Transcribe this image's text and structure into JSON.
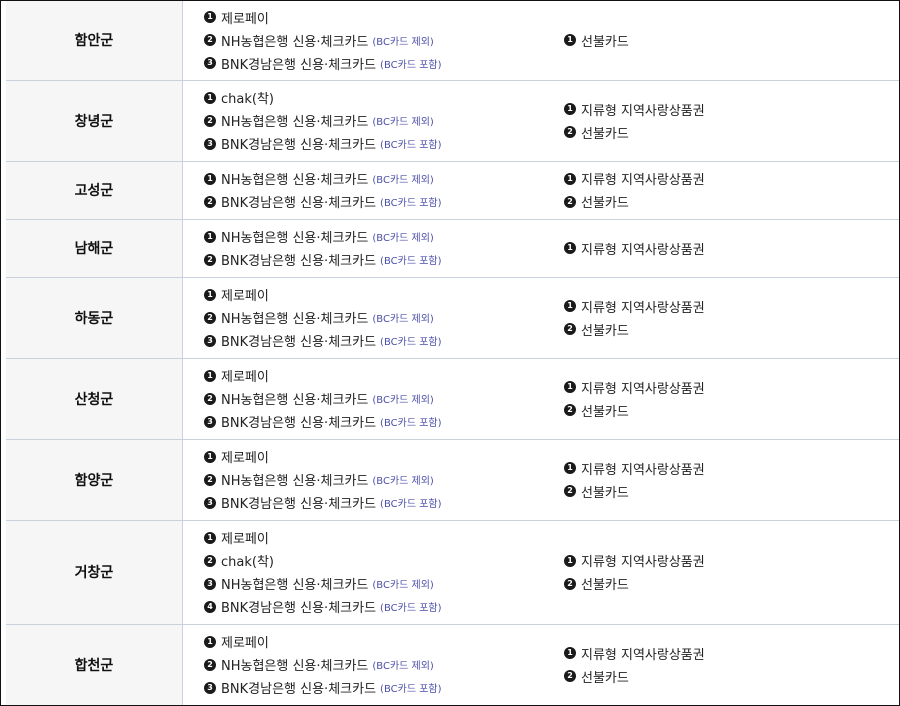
{
  "colors": {
    "note": "#4b4fa8",
    "region_bg": "#f6f6f6",
    "divider": "#c9d1dc",
    "badge": "#1a1a1a"
  },
  "rows": [
    {
      "region": "함안군",
      "payments": [
        {
          "num": "1",
          "text": "제로페이",
          "note": ""
        },
        {
          "num": "2",
          "text": "NH농협은행 신용·체크카드",
          "note": "(BC카드 제외)"
        },
        {
          "num": "3",
          "text": "BNK경남은행 신용·체크카드",
          "note": "(BC카드 포함)"
        }
      ],
      "vouchers": [
        {
          "num": "1",
          "text": "선불카드"
        }
      ]
    },
    {
      "region": "창녕군",
      "payments": [
        {
          "num": "1",
          "text": "chak(착)",
          "note": ""
        },
        {
          "num": "2",
          "text": "NH농협은행 신용·체크카드",
          "note": "(BC카드 제외)"
        },
        {
          "num": "3",
          "text": "BNK경남은행 신용·체크카드",
          "note": "(BC카드 포함)"
        }
      ],
      "vouchers": [
        {
          "num": "1",
          "text": "지류형 지역사랑상품권"
        },
        {
          "num": "2",
          "text": "선불카드"
        }
      ]
    },
    {
      "region": "고성군",
      "payments": [
        {
          "num": "1",
          "text": "NH농협은행 신용·체크카드",
          "note": "(BC카드 제외)"
        },
        {
          "num": "2",
          "text": "BNK경남은행 신용·체크카드",
          "note": "(BC카드 포함)"
        }
      ],
      "vouchers": [
        {
          "num": "1",
          "text": "지류형 지역사랑상품권"
        },
        {
          "num": "2",
          "text": "선불카드"
        }
      ]
    },
    {
      "region": "남해군",
      "payments": [
        {
          "num": "1",
          "text": "NH농협은행 신용·체크카드",
          "note": "(BC카드 제외)"
        },
        {
          "num": "2",
          "text": "BNK경남은행 신용·체크카드",
          "note": "(BC카드 포함)"
        }
      ],
      "vouchers": [
        {
          "num": "1",
          "text": "지류형 지역사랑상품권"
        }
      ]
    },
    {
      "region": "하동군",
      "payments": [
        {
          "num": "1",
          "text": "제로페이",
          "note": ""
        },
        {
          "num": "2",
          "text": "NH농협은행 신용·체크카드",
          "note": "(BC카드 제외)"
        },
        {
          "num": "3",
          "text": "BNK경남은행 신용·체크카드",
          "note": "(BC카드 포함)"
        }
      ],
      "vouchers": [
        {
          "num": "1",
          "text": "지류형 지역사랑상품권"
        },
        {
          "num": "2",
          "text": "선불카드"
        }
      ]
    },
    {
      "region": "산청군",
      "payments": [
        {
          "num": "1",
          "text": "제로페이",
          "note": ""
        },
        {
          "num": "2",
          "text": "NH농협은행 신용·체크카드",
          "note": "(BC카드 제외)"
        },
        {
          "num": "3",
          "text": "BNK경남은행 신용·체크카드",
          "note": "(BC카드 포함)"
        }
      ],
      "vouchers": [
        {
          "num": "1",
          "text": "지류형 지역사랑상품권"
        },
        {
          "num": "2",
          "text": "선불카드"
        }
      ]
    },
    {
      "region": "함양군",
      "payments": [
        {
          "num": "1",
          "text": "제로페이",
          "note": ""
        },
        {
          "num": "2",
          "text": "NH농협은행 신용·체크카드",
          "note": "(BC카드 제외)"
        },
        {
          "num": "3",
          "text": "BNK경남은행 신용·체크카드",
          "note": "(BC카드 포함)"
        }
      ],
      "vouchers": [
        {
          "num": "1",
          "text": "지류형 지역사랑상품권"
        },
        {
          "num": "2",
          "text": "선불카드"
        }
      ]
    },
    {
      "region": "거창군",
      "payments": [
        {
          "num": "1",
          "text": "제로페이",
          "note": ""
        },
        {
          "num": "2",
          "text": "chak(착)",
          "note": ""
        },
        {
          "num": "3",
          "text": "NH농협은행 신용·체크카드",
          "note": "(BC카드 제외)"
        },
        {
          "num": "4",
          "text": "BNK경남은행 신용·체크카드",
          "note": "(BC카드 포함)"
        }
      ],
      "vouchers": [
        {
          "num": "1",
          "text": "지류형 지역사랑상품권"
        },
        {
          "num": "2",
          "text": "선불카드"
        }
      ]
    },
    {
      "region": "합천군",
      "payments": [
        {
          "num": "1",
          "text": "제로페이",
          "note": ""
        },
        {
          "num": "2",
          "text": "NH농협은행 신용·체크카드",
          "note": "(BC카드 제외)"
        },
        {
          "num": "3",
          "text": "BNK경남은행 신용·체크카드",
          "note": "(BC카드 포함)"
        }
      ],
      "vouchers": [
        {
          "num": "1",
          "text": "지류형 지역사랑상품권"
        },
        {
          "num": "2",
          "text": "선불카드"
        }
      ]
    }
  ]
}
